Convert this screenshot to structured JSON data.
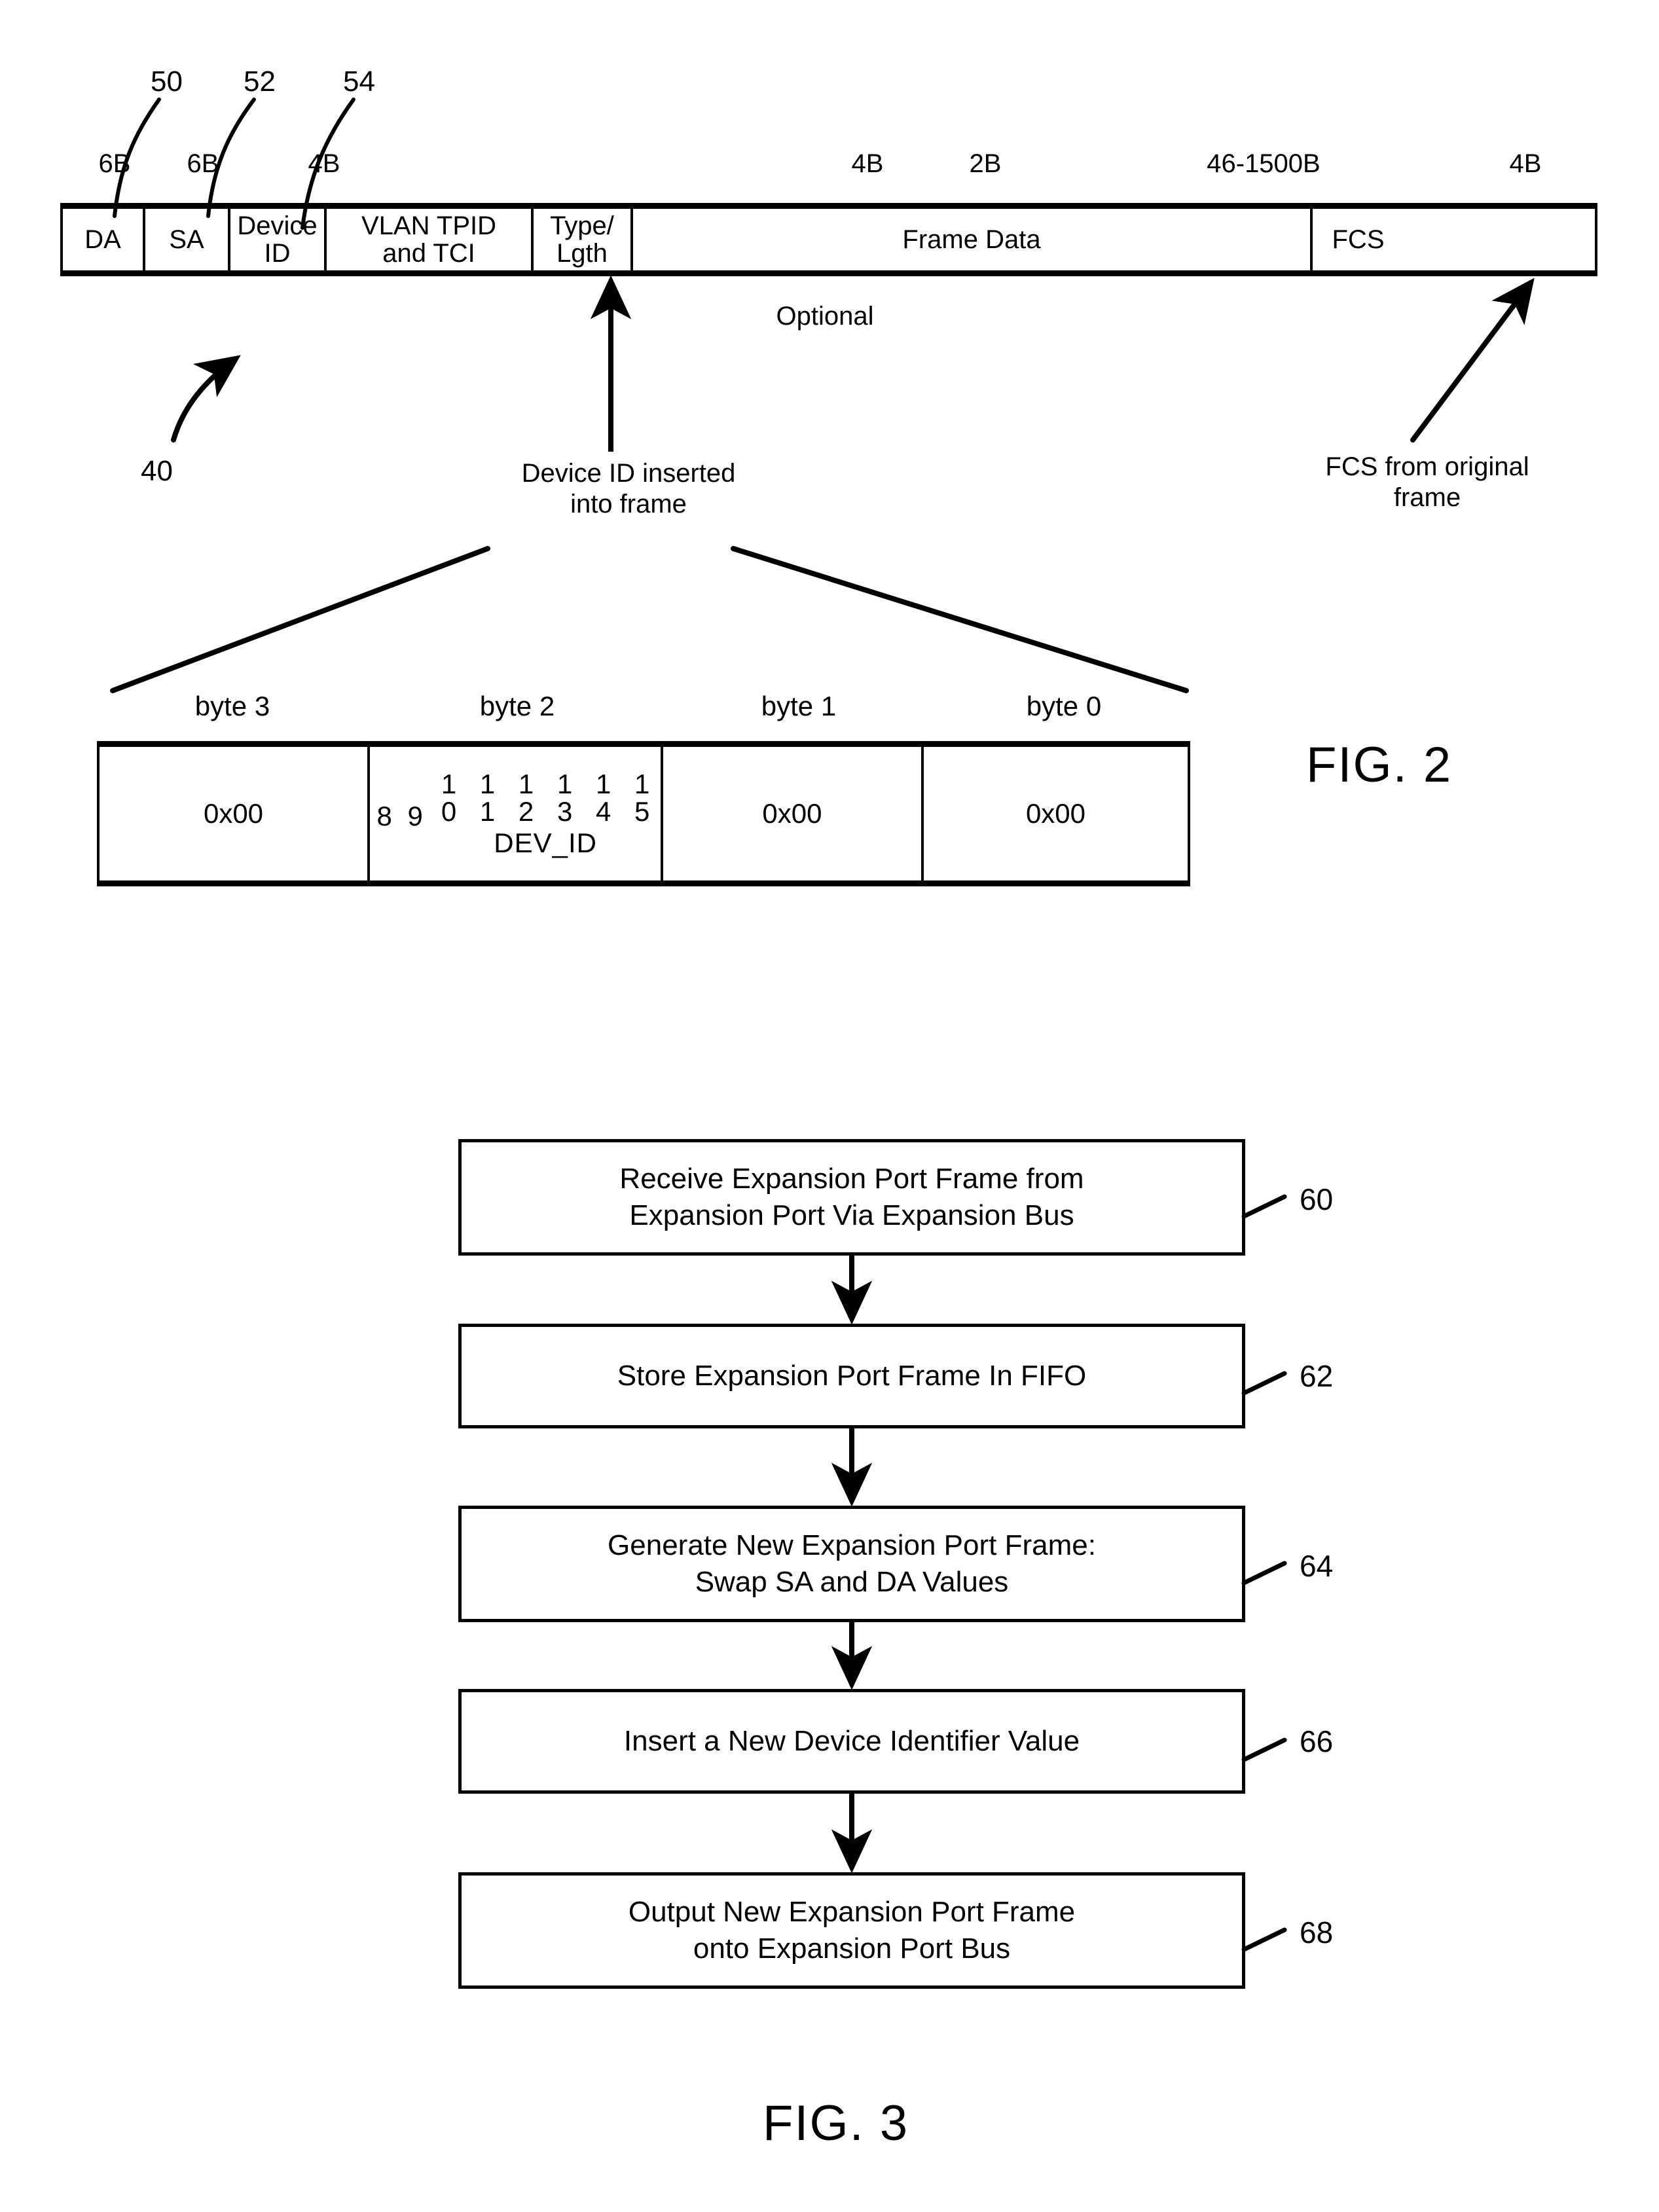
{
  "figure2": {
    "label": "FIG. 2",
    "frame_reference": "40",
    "field_references": [
      "50",
      "52",
      "54"
    ],
    "size_labels": [
      "6B",
      "6B",
      "4B",
      "4B",
      "2B",
      "46-1500B",
      "4B"
    ],
    "fields": [
      {
        "name": "DA",
        "size": "6B"
      },
      {
        "name": "SA",
        "size": "6B"
      },
      {
        "name": "Device ID",
        "size": "4B"
      },
      {
        "name": "VLAN TPID and TCI",
        "size": "4B"
      },
      {
        "name": "Type/ Lgth",
        "size": "2B"
      },
      {
        "name": "Frame Data",
        "size": "46-1500B"
      },
      {
        "name": "FCS",
        "size": "4B"
      }
    ],
    "field_labels": {
      "da": "DA",
      "sa": "SA",
      "device_id": "Device ID",
      "vlan_line1": "VLAN TPID",
      "vlan_line2": "and TCI",
      "type_line1": "Type/",
      "type_line2": "Lgth",
      "frame_data": "Frame Data",
      "fcs": "FCS"
    },
    "optional_label": "Optional",
    "annotations": {
      "device_id_inserted_line1": "Device ID inserted",
      "device_id_inserted_line2": "into frame",
      "fcs_origin_line1": "FCS from original",
      "fcs_origin_line2": "frame"
    },
    "byte_table": {
      "headers": [
        "byte 3",
        "byte 2",
        "byte 1",
        "byte 0"
      ],
      "values": [
        "0x00",
        "",
        "0x00",
        "0x00"
      ],
      "byte2": {
        "low_bits": "8 9",
        "bit_row_top": "1 1 1 1 1 1",
        "bit_row_bottom": "0 1 2 3 4 5",
        "field_name": "DEV_ID"
      }
    }
  },
  "figure3": {
    "label": "FIG. 3",
    "steps": [
      {
        "ref": "60",
        "line1": "Receive Expansion Port Frame from",
        "line2": "Expansion Port Via Expansion Bus"
      },
      {
        "ref": "62",
        "line1": "Store Expansion Port Frame In FIFO",
        "line2": ""
      },
      {
        "ref": "64",
        "line1": "Generate New Expansion Port Frame:",
        "line2": "Swap SA and DA Values"
      },
      {
        "ref": "66",
        "line1": "Insert a New Device Identifier Value",
        "line2": ""
      },
      {
        "ref": "68",
        "line1": "Output New Expansion Port Frame",
        "line2": "onto Expansion Port Bus"
      }
    ]
  },
  "colors": {
    "ink": "#000000",
    "paper": "#ffffff"
  }
}
